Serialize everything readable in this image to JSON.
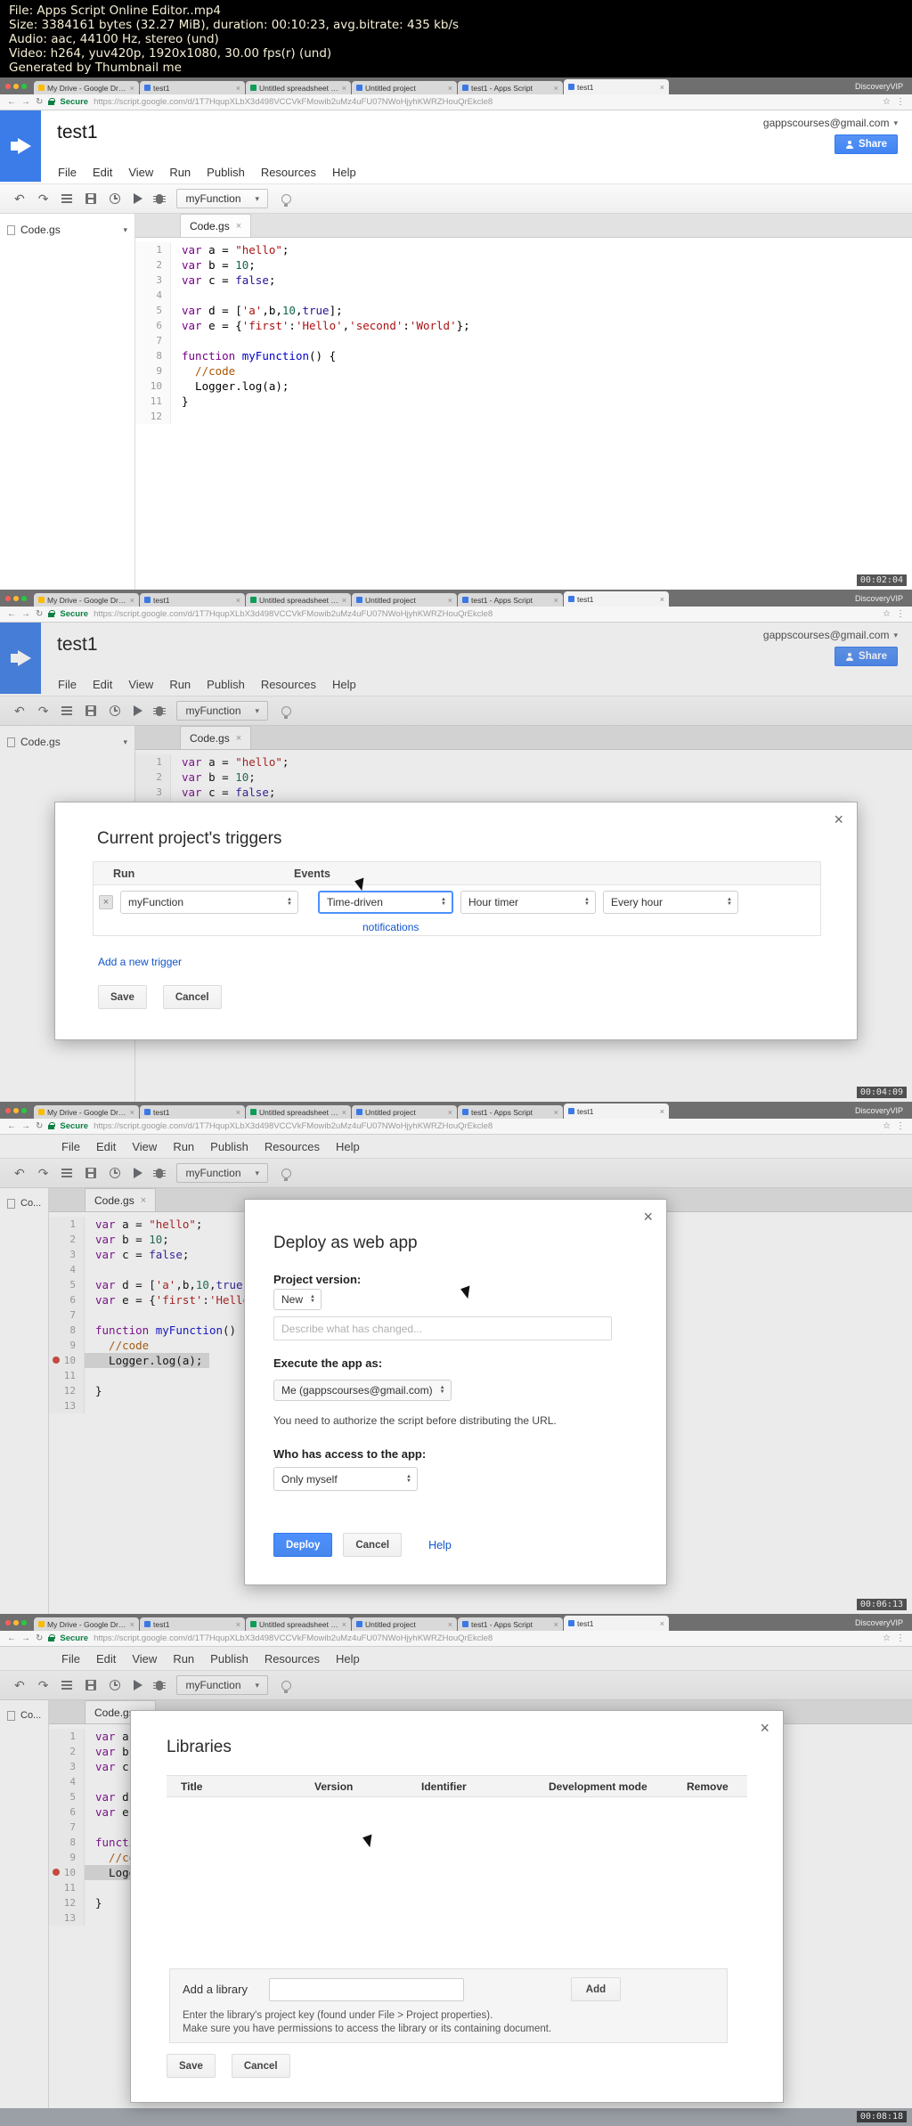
{
  "colors": {
    "accent": "#4d90fe",
    "logo_blue": "#3b7ce8",
    "secure_green": "#0b8043"
  },
  "meta": {
    "line1": "File: Apps Script Online Editor..mp4",
    "line2": "Size: 3384161 bytes (32.27 MiB), duration: 00:10:23, avg.bitrate: 435 kb/s",
    "line3": "Audio: aac, 44100 Hz, stereo (und)",
    "line4": "Video: h264, yuv420p, 1920x1080, 30.00 fps(r) (und)",
    "line5": "Generated by Thumbnail me"
  },
  "browser": {
    "tabs": [
      {
        "label": "My Drive - Google Drive",
        "color": "#fbbc05"
      },
      {
        "label": "test1",
        "color": "#3b78e7"
      },
      {
        "label": "Untitled spreadsheet - Goog...",
        "color": "#0f9d58"
      },
      {
        "label": "Untitled project",
        "color": "#3b78e7"
      },
      {
        "label": "test1 - Apps Script",
        "color": "#3b78e7"
      },
      {
        "label": "test1",
        "color": "#3b78e7"
      }
    ],
    "secure_label": "Secure",
    "url": "https://script.google.com/d/1T7HqupXLbX3d498VCCVkFMowib2uMz4uFU07NWoHjyhKWRZHouQrEkcle8",
    "watermark": "DiscoveryVIP"
  },
  "editor": {
    "project_title": "test1",
    "account": "gappscourses@gmail.com",
    "share_label": "Share",
    "menus": [
      "File",
      "Edit",
      "View",
      "Run",
      "Publish",
      "Resources",
      "Help"
    ],
    "function_select": "myFunction",
    "sidebar_file": "Code.gs",
    "sidebar_file_short": "Co...",
    "tab_label": "Code.gs"
  },
  "code1": [
    {
      "t": [
        {
          "c": "kw",
          "s": "var"
        },
        {
          "c": "pln",
          "s": " a = "
        },
        {
          "c": "str",
          "s": "\"hello\""
        },
        {
          "c": "pln",
          "s": ";"
        }
      ]
    },
    {
      "t": [
        {
          "c": "kw",
          "s": "var"
        },
        {
          "c": "pln",
          "s": " b = "
        },
        {
          "c": "num",
          "s": "10"
        },
        {
          "c": "pln",
          "s": ";"
        }
      ]
    },
    {
      "t": [
        {
          "c": "kw",
          "s": "var"
        },
        {
          "c": "pln",
          "s": " c = "
        },
        {
          "c": "atom",
          "s": "false"
        },
        {
          "c": "pln",
          "s": ";"
        }
      ]
    },
    {
      "t": []
    },
    {
      "t": [
        {
          "c": "kw",
          "s": "var"
        },
        {
          "c": "pln",
          "s": " d = ["
        },
        {
          "c": "str",
          "s": "'a'"
        },
        {
          "c": "pln",
          "s": ",b,"
        },
        {
          "c": "num",
          "s": "10"
        },
        {
          "c": "pln",
          "s": ","
        },
        {
          "c": "atom",
          "s": "true"
        },
        {
          "c": "pln",
          "s": "];"
        }
      ]
    },
    {
      "t": [
        {
          "c": "kw",
          "s": "var"
        },
        {
          "c": "pln",
          "s": " e = {"
        },
        {
          "c": "str",
          "s": "'first'"
        },
        {
          "c": "pln",
          "s": ":"
        },
        {
          "c": "str",
          "s": "'Hello'"
        },
        {
          "c": "pln",
          "s": ","
        },
        {
          "c": "str",
          "s": "'second'"
        },
        {
          "c": "pln",
          "s": ":"
        },
        {
          "c": "str",
          "s": "'World'"
        },
        {
          "c": "pln",
          "s": "};"
        }
      ]
    },
    {
      "t": []
    },
    {
      "t": [
        {
          "c": "kw",
          "s": "function"
        },
        {
          "c": "pln",
          "s": " "
        },
        {
          "c": "def",
          "s": "myFunction"
        },
        {
          "c": "pln",
          "s": "() {"
        }
      ]
    },
    {
      "t": [
        {
          "c": "com",
          "s": "  //code"
        }
      ]
    },
    {
      "t": [
        {
          "c": "pln",
          "s": "  Logger.log(a);"
        }
      ]
    },
    {
      "t": [
        {
          "c": "pln",
          "s": "}"
        }
      ]
    },
    {
      "t": []
    }
  ],
  "code2": [
    {
      "t": [
        {
          "c": "kw",
          "s": "var"
        },
        {
          "c": "pln",
          "s": " a = "
        },
        {
          "c": "str",
          "s": "\"hello\""
        },
        {
          "c": "pln",
          "s": ";"
        }
      ]
    },
    {
      "t": [
        {
          "c": "kw",
          "s": "var"
        },
        {
          "c": "pln",
          "s": " b = "
        },
        {
          "c": "num",
          "s": "10"
        },
        {
          "c": "pln",
          "s": ";"
        }
      ]
    },
    {
      "t": [
        {
          "c": "kw",
          "s": "var"
        },
        {
          "c": "pln",
          "s": " c = "
        },
        {
          "c": "atom",
          "s": "false"
        },
        {
          "c": "pln",
          "s": ";"
        }
      ]
    },
    {
      "t": []
    },
    {
      "t": [
        {
          "c": "kw",
          "s": "var"
        },
        {
          "c": "pln",
          "s": " d = ["
        },
        {
          "c": "str",
          "s": "'a'"
        },
        {
          "c": "pln",
          "s": ",b,"
        },
        {
          "c": "num",
          "s": "10"
        },
        {
          "c": "pln",
          "s": ","
        },
        {
          "c": "atom",
          "s": "true"
        },
        {
          "c": "pln",
          "s": "];"
        }
      ]
    },
    {
      "t": [
        {
          "c": "kw",
          "s": "var"
        },
        {
          "c": "pln",
          "s": " e = {"
        },
        {
          "c": "str",
          "s": "'first'"
        },
        {
          "c": "pln",
          "s": ":"
        },
        {
          "c": "str",
          "s": "'Hello'"
        },
        {
          "c": "pln",
          "s": ","
        },
        {
          "c": "str",
          "s": "'second'"
        },
        {
          "c": "pln",
          "s": ":"
        },
        {
          "c": "str",
          "s": "'World'"
        },
        {
          "c": "pln",
          "s": "};"
        }
      ]
    },
    {
      "t": []
    },
    {
      "t": [
        {
          "c": "kw",
          "s": "function"
        },
        {
          "c": "pln",
          "s": " "
        },
        {
          "c": "def",
          "s": "myFunction"
        },
        {
          "c": "pln",
          "s": "() {"
        }
      ]
    },
    {
      "t": [
        {
          "c": "com",
          "s": "  //code"
        }
      ]
    },
    {
      "bp": true,
      "hl": true,
      "t": [
        {
          "c": "pln",
          "s": "  Logger.log(a);"
        }
      ]
    },
    {
      "t": []
    },
    {
      "t": [
        {
          "c": "pln",
          "s": "}"
        }
      ]
    },
    {
      "t": []
    }
  ],
  "frames": [
    {
      "timestamp": "00:02:04"
    },
    {
      "timestamp": "00:04:09"
    },
    {
      "timestamp": "00:06:13"
    },
    {
      "timestamp": "00:08:18"
    }
  ],
  "triggers": {
    "title": "Current project's triggers",
    "col_run": "Run",
    "col_events": "Events",
    "run_value": "myFunction",
    "event_type": "Time-driven",
    "timer_type": "Hour timer",
    "interval": "Every hour",
    "notifications": "notifications",
    "add_trigger": "Add a new trigger",
    "save": "Save",
    "cancel": "Cancel"
  },
  "deploy": {
    "title": "Deploy as web app",
    "version_label": "Project version:",
    "version_value": "New",
    "describe_placeholder": "Describe what has changed...",
    "execute_label": "Execute the app as:",
    "execute_value": "Me (gappscourses@gmail.com)",
    "authorize_note": "You need to authorize the script before distributing the URL.",
    "access_label": "Who has access to the app:",
    "access_value": "Only myself",
    "deploy": "Deploy",
    "cancel": "Cancel",
    "help": "Help"
  },
  "libraries": {
    "title": "Libraries",
    "col_title": "Title",
    "col_version": "Version",
    "col_identifier": "Identifier",
    "col_devmode": "Development mode",
    "col_remove": "Remove",
    "add_label": "Add a library",
    "add_button": "Add",
    "note1": "Enter the library's project key (found under File > Project properties).",
    "note2": "Make sure you have permissions to access the library or its containing document.",
    "save": "Save",
    "cancel": "Cancel"
  }
}
